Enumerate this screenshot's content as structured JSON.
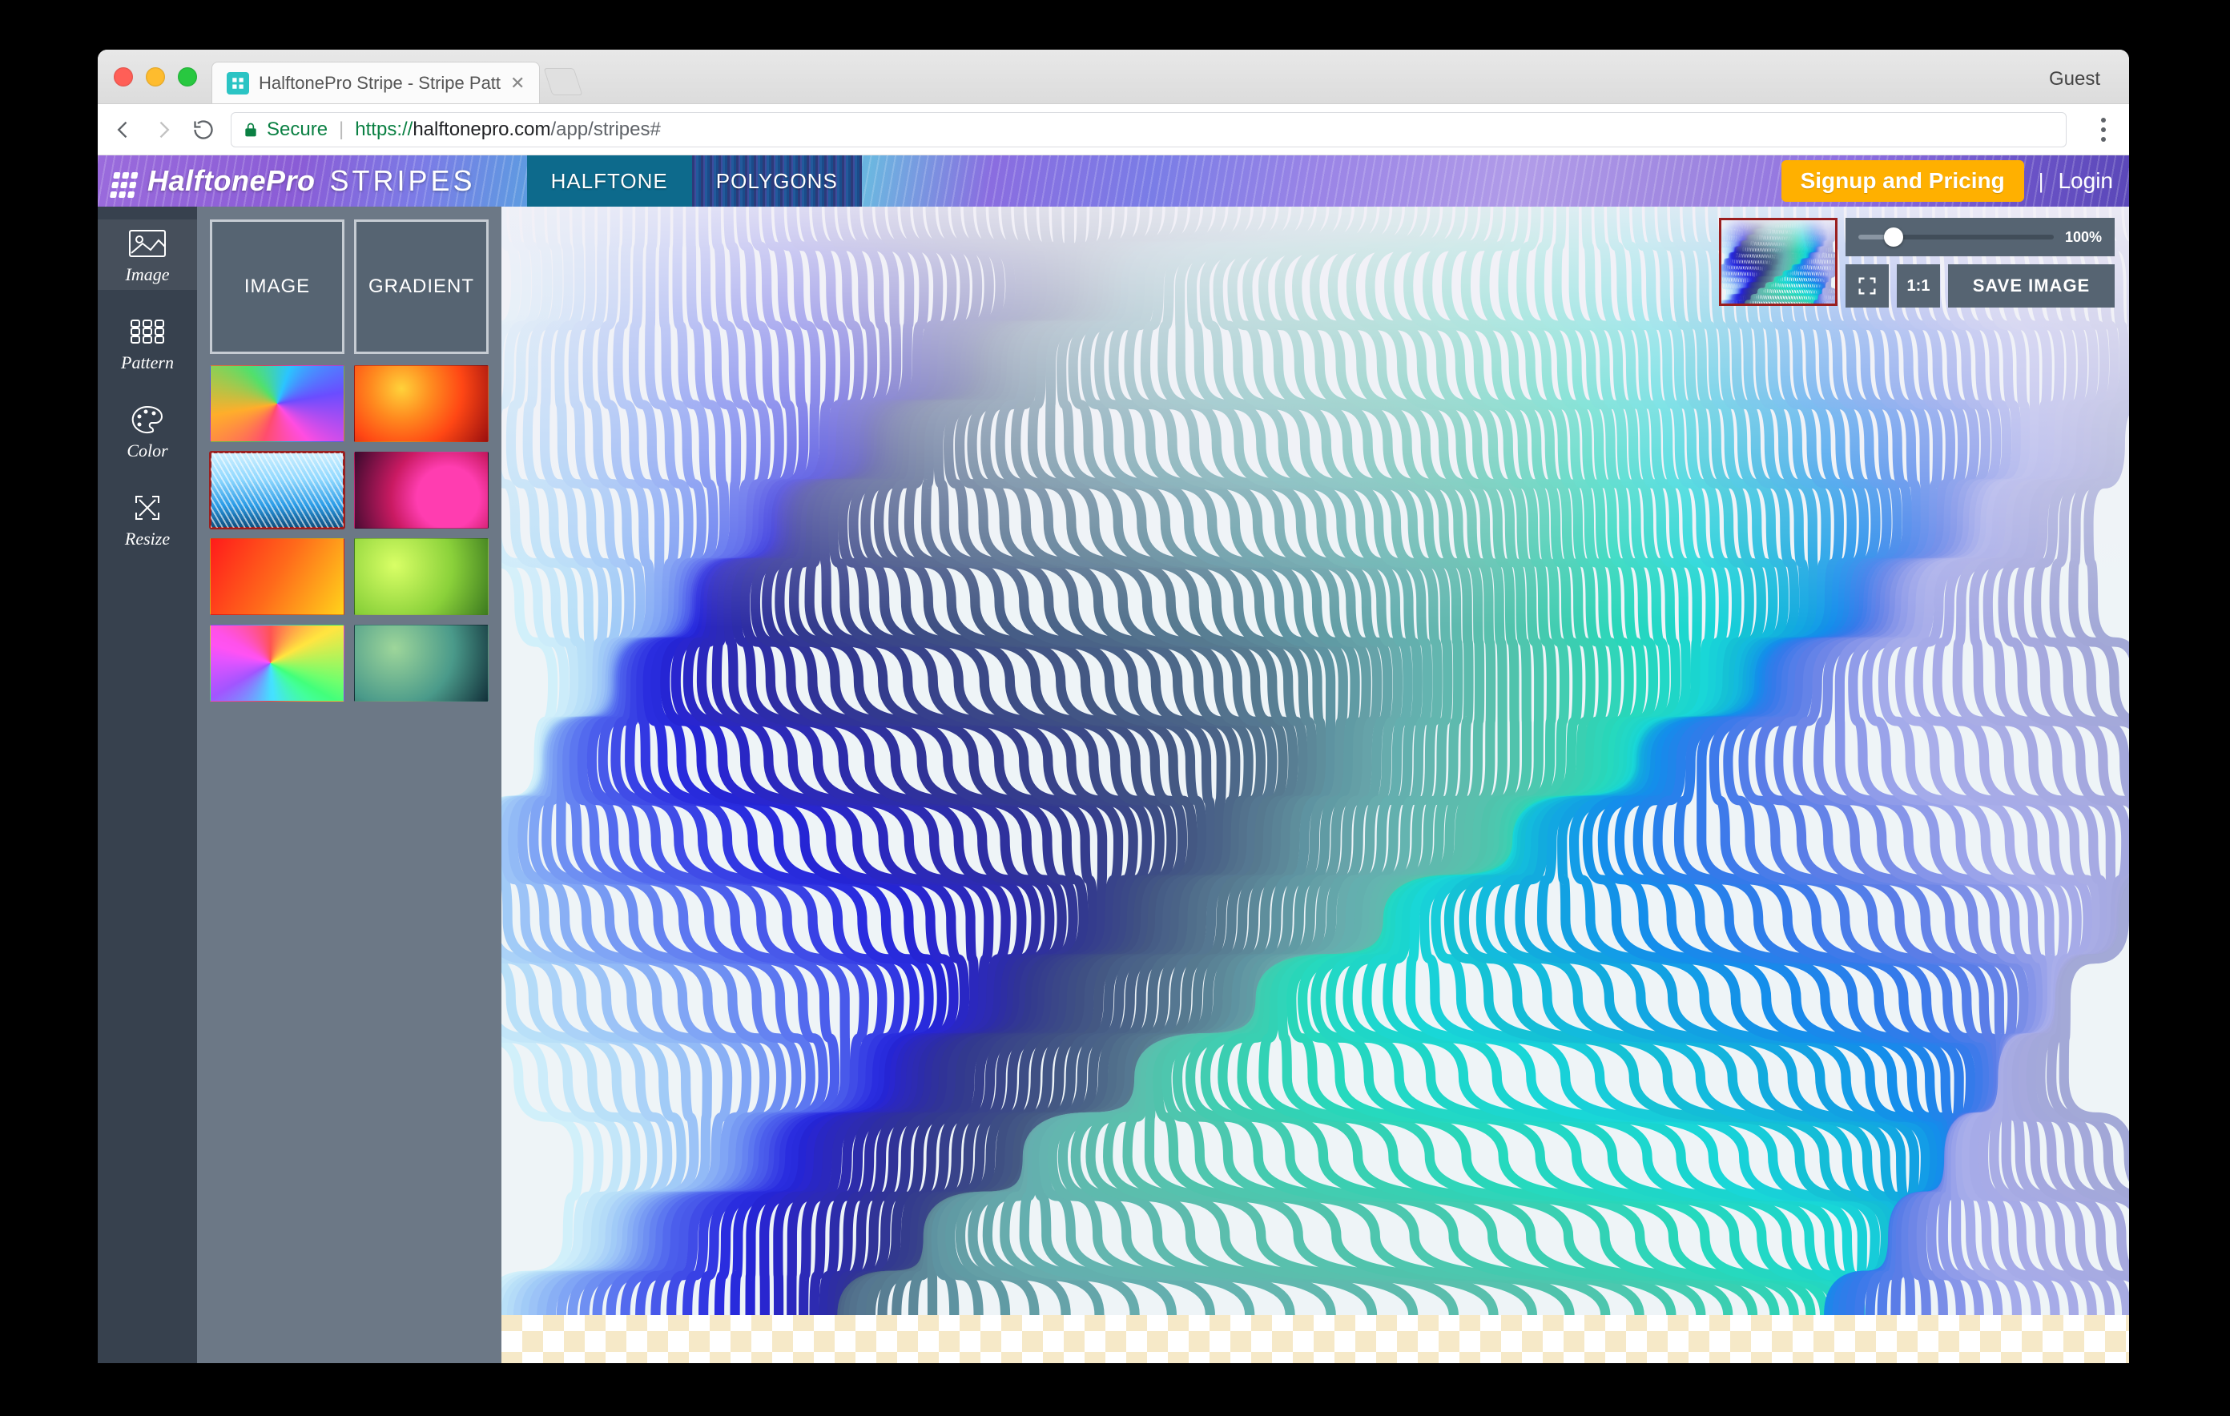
{
  "browser": {
    "tab_title": "HalftonePro Stripe - Stripe Patt",
    "guest_label": "Guest",
    "secure_label": "Secure",
    "url_scheme": "https://",
    "url_host": "halftonepro.com",
    "url_path": "/app/stripes#"
  },
  "header": {
    "brand_main": "HalftonePro",
    "brand_sub": "STRIPES",
    "nav": {
      "halftone": "HALFTONE",
      "polygons": "POLYGONS"
    },
    "signup": "Signup and Pricing",
    "login": "Login",
    "separator": "|"
  },
  "sidebar": {
    "items": [
      {
        "key": "image",
        "label": "Image",
        "active": true
      },
      {
        "key": "pattern",
        "label": "Pattern",
        "active": false
      },
      {
        "key": "color",
        "label": "Color",
        "active": false
      },
      {
        "key": "resize",
        "label": "Resize",
        "active": false
      }
    ]
  },
  "panel": {
    "mode_image": "IMAGE",
    "mode_gradient": "GRADIENT",
    "thumbnails": [
      {
        "key": "spectrum",
        "active": false
      },
      {
        "key": "sunset",
        "active": false
      },
      {
        "key": "ice",
        "active": true
      },
      {
        "key": "magenta",
        "active": false
      },
      {
        "key": "fire",
        "active": false
      },
      {
        "key": "lime",
        "active": false
      },
      {
        "key": "prism",
        "active": false
      },
      {
        "key": "teal",
        "active": false
      }
    ]
  },
  "controls": {
    "zoom_percent": 100,
    "zoom_label": "100%",
    "slider_position_pct": 18,
    "one_to_one": "1:1",
    "save_image": "SAVE IMAGE"
  },
  "colors": {
    "signup_bg": "#ffb000",
    "accent_purple": "#7c5bc5",
    "slate": "#566472",
    "preview_border": "#9a1f1f"
  }
}
